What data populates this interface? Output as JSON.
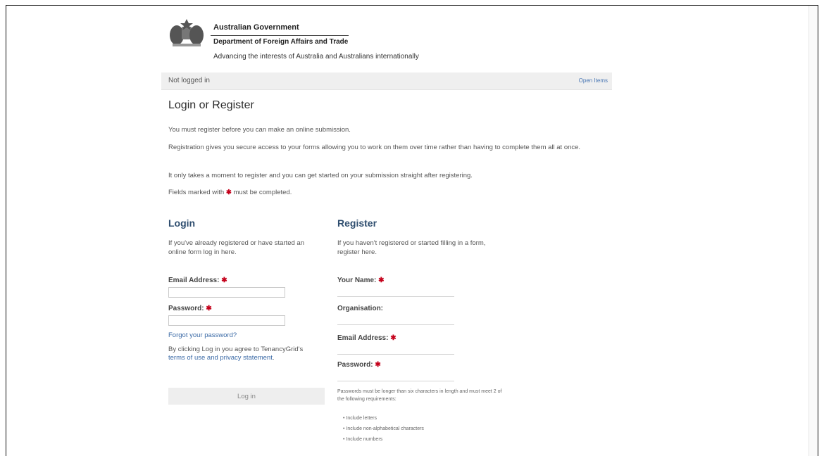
{
  "header": {
    "government": "Australian Government",
    "department": "Department of Foreign Affairs and Trade",
    "tagline": "Advancing the interests of Australia and Australians internationally"
  },
  "status_bar": {
    "status": "Not logged in",
    "link": "Open Items"
  },
  "page": {
    "title": "Login or Register",
    "intro_1": "You must register before you can make an online submission.",
    "intro_2": "Registration gives you secure access to your forms allowing you to work on them over time rather than having to complete them all at once.",
    "intro_3": "It only takes a moment to register and you can get started on your submission straight after registering.",
    "intro_4_before": "Fields marked with",
    "intro_4_marker": "✱",
    "intro_4_after": "must be completed."
  },
  "login": {
    "heading": "Login",
    "description": "If you've already registered or have started an online form log in here.",
    "email_label": "Email Address:",
    "password_label": "Password:",
    "required_marker": "✱",
    "forgot_link": "Forgot your password?",
    "terms_before": "By clicking Log in you agree to TenancyGrid's",
    "terms_link": "terms of use and privacy statement",
    "terms_after": ".",
    "button": "Log in"
  },
  "register": {
    "heading": "Register",
    "description": "If you haven't registered or started filling in a form, register here.",
    "name_label": "Your Name:",
    "organisation_label": "Organisation:",
    "email_label": "Email Address:",
    "password_label": "Password:",
    "required_marker": "✱",
    "password_note": "Passwords must be longer than six characters in length and must meet 2 of the following requirements:",
    "password_rules": [
      "Include letters",
      "Include non-alphabetical characters",
      "Include numbers"
    ]
  },
  "colors": {
    "heading": "#2f4e6f",
    "link": "#3b6aa6",
    "required": "#c4001a",
    "status_bar": "#efefef"
  },
  "icons": {
    "crest": "coat-of-arms-icon"
  }
}
